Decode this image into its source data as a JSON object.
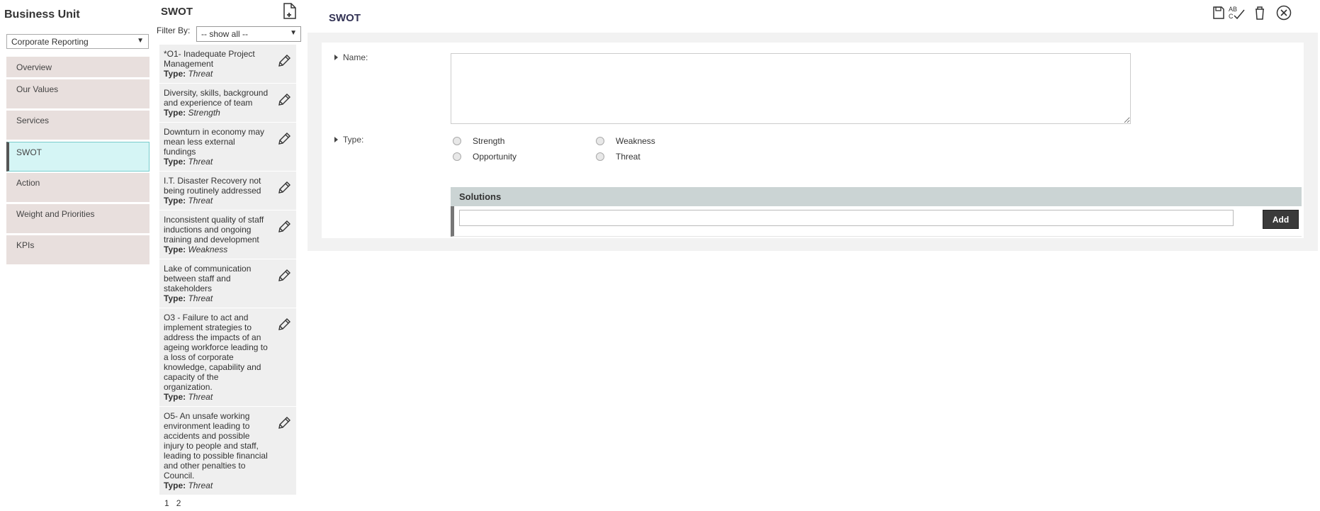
{
  "business_unit": {
    "title": "Business Unit",
    "selected": "Corporate Reporting",
    "nav": [
      {
        "label": "Overview",
        "active": false
      },
      {
        "label": "Our Values",
        "active": false
      },
      {
        "label": "Services",
        "active": false
      },
      {
        "label": "SWOT",
        "active": true
      },
      {
        "label": "Action",
        "active": false
      },
      {
        "label": "Weight and Priorities",
        "active": false
      },
      {
        "label": "KPIs",
        "active": false
      }
    ]
  },
  "list": {
    "title": "SWOT",
    "filter_label": "Filter By:",
    "filter_value": "-- show all --",
    "type_label": "Type:",
    "items": [
      {
        "text": "*O1- Inadequate Project Management",
        "type": "Threat"
      },
      {
        "text": "Diversity, skills, background and experience of team",
        "type": "Strength"
      },
      {
        "text": "Downturn in economy may mean less external fundings",
        "type": "Threat"
      },
      {
        "text": "I.T. Disaster Recovery not being routinely addressed",
        "type": "Threat"
      },
      {
        "text": "Inconsistent quality of staff inductions and ongoing training and development",
        "type": "Weakness"
      },
      {
        "text": "Lake of communication between staff and stakeholders",
        "type": "Threat"
      },
      {
        "text": "O3 - Failure to act and implement strategies to address the impacts of an ageing workforce leading to a loss of corporate knowledge, capability and capacity of the organization.",
        "type": "Threat"
      },
      {
        "text": "O5- An unsafe working environment leading to accidents and possible injury to people and staff, leading to possible financial and other penalties to Council.",
        "type": "Threat"
      }
    ],
    "pages": [
      "1",
      "2"
    ]
  },
  "panel": {
    "title": "SWOT",
    "name_label": "Name:",
    "type_label": "Type:",
    "type_options": [
      "Strength",
      "Weakness",
      "Opportunity",
      "Threat"
    ],
    "solutions_title": "Solutions",
    "add_label": "Add"
  }
}
